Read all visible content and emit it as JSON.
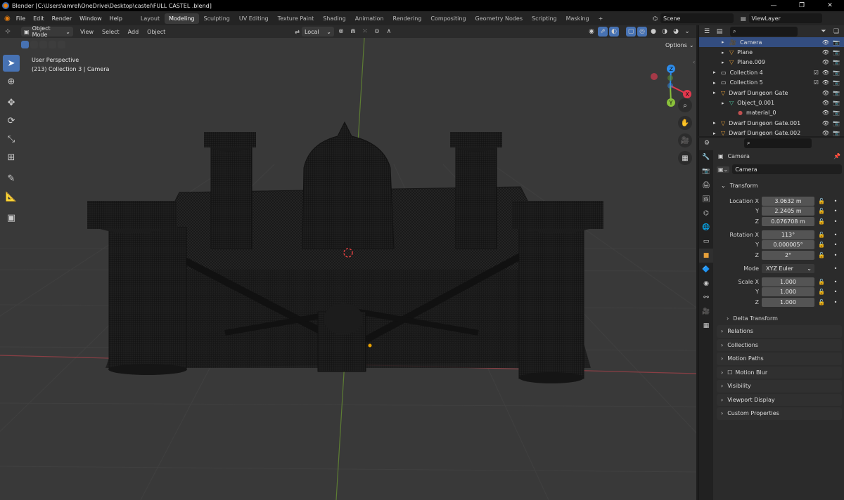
{
  "window": {
    "title": "Blender [C:\\Users\\amrel\\OneDrive\\Desktop\\castel\\FULL CASTEL .blend]",
    "controls": [
      "—",
      "❐",
      "✕"
    ]
  },
  "menu": [
    "File",
    "Edit",
    "Render",
    "Window",
    "Help"
  ],
  "workspaces": [
    "Layout",
    "Modeling",
    "Sculpting",
    "UV Editing",
    "Texture Paint",
    "Shading",
    "Animation",
    "Rendering",
    "Compositing",
    "Geometry Nodes",
    "Scripting",
    "Masking"
  ],
  "active_workspace": "Modeling",
  "add_tab": "+",
  "scene": {
    "value": "Scene"
  },
  "view_layer": {
    "value": "ViewLayer"
  },
  "viewport_header": {
    "mode": "Object Mode",
    "menus": [
      "View",
      "Select",
      "Add",
      "Object"
    ],
    "orientation": "Local",
    "options": "Options"
  },
  "viewport": {
    "perspective": "User Perspective",
    "context": "(213) Collection 3 | Camera",
    "gizmo": {
      "x": "X",
      "y": "Y",
      "z": "Z"
    },
    "colors": {
      "x": "#e4374d",
      "y": "#8ac13b",
      "z": "#2d8ceb",
      "grid": "#454545",
      "bg": "#393939",
      "mesh": "#141414"
    }
  },
  "outliner": {
    "items": [
      {
        "name": "Camera",
        "indent": 2,
        "icon": "camera-object-icon",
        "selected": true
      },
      {
        "name": "Plane",
        "indent": 2,
        "icon": "mesh-object-icon",
        "selected": false
      },
      {
        "name": "Plane.009",
        "indent": 2,
        "icon": "mesh-object-icon",
        "selected": false
      },
      {
        "name": "Collection 4",
        "indent": 1,
        "icon": "collection-icon",
        "selected": false
      },
      {
        "name": "Collection 5",
        "indent": 1,
        "icon": "collection-icon",
        "selected": false
      },
      {
        "name": "Dwarf Dungeon Gate",
        "indent": 1,
        "icon": "mesh-object-icon",
        "selected": false
      },
      {
        "name": "Object_0.001",
        "indent": 2,
        "icon": "mesh-data-icon",
        "selected": false
      },
      {
        "name": "material_0",
        "indent": 3,
        "icon": "material-icon",
        "selected": false
      },
      {
        "name": "Dwarf Dungeon Gate.001",
        "indent": 1,
        "icon": "mesh-object-icon",
        "selected": false
      },
      {
        "name": "Dwarf Dungeon Gate.002",
        "indent": 1,
        "icon": "mesh-object-icon",
        "selected": false
      }
    ]
  },
  "properties": {
    "object_name": "Camera",
    "data_name": "Camera",
    "transform": {
      "title": "Transform",
      "location": {
        "label": "Location X",
        "x": "3.0632 m",
        "y": "2.2405 m",
        "z": "0.076708 m"
      },
      "rotation": {
        "label": "Rotation X",
        "x": "113°",
        "y": "0.000005°",
        "z": "2°"
      },
      "mode": {
        "label": "Mode",
        "value": "XYZ Euler"
      },
      "scale": {
        "label": "Scale X",
        "x": "1.000",
        "y": "1.000",
        "z": "1.000"
      },
      "axis_y": "Y",
      "axis_z": "Z",
      "delta": "Delta Transform"
    },
    "panels": [
      "Relations",
      "Collections",
      "Motion Paths",
      "Motion Blur",
      "Visibility",
      "Viewport Display",
      "Custom Properties"
    ]
  }
}
